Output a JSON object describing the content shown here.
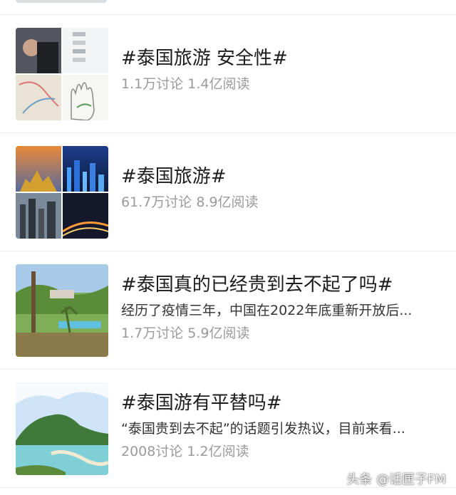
{
  "topics": [
    {
      "title": "#泰国旅游 安全性#",
      "stats": "1.1万讨论 1.4亿阅读",
      "thumb_icon": "collage-image"
    },
    {
      "title": "#泰国旅游#",
      "stats": "61.7万讨论 8.9亿阅读",
      "thumb_icon": "collage-image"
    },
    {
      "title": "#泰国真的已经贵到去不起了吗#",
      "desc": "经历了疫情三年，中国在2022年底重新开放后...",
      "stats": "1.7万讨论 5.9亿阅读",
      "thumb_icon": "resort-image"
    },
    {
      "title": "#泰国游有平替吗#",
      "desc": "“泰国贵到去不起”的话题引发热议，目前来看...",
      "stats": "2008讨论 1.2亿阅读",
      "thumb_icon": "island-image"
    }
  ],
  "watermark": "头条 @话匣子FM",
  "colors": {
    "title": "#1c1c1c",
    "meta": "#9a9a9a",
    "divider": "#ececec"
  }
}
